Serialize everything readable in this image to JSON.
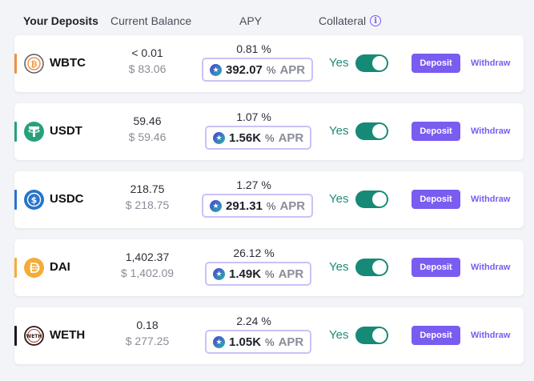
{
  "header": {
    "deposits": "Your Deposits",
    "balance": "Current Balance",
    "apy": "APY",
    "collateral": "Collateral"
  },
  "rows": [
    {
      "symbol": "WBTC",
      "balance": "< 0.01",
      "usd": "$ 83.06",
      "apy": "0.81 %",
      "apr": "392.07",
      "collateral": "Yes",
      "accent": "#f09242",
      "icon": "wbtc-icon"
    },
    {
      "symbol": "USDT",
      "balance": "59.46",
      "usd": "$ 59.46",
      "apy": "1.07 %",
      "apr": "1.56K",
      "collateral": "Yes",
      "accent": "#26a17b",
      "icon": "usdt-icon"
    },
    {
      "symbol": "USDC",
      "balance": "218.75",
      "usd": "$ 218.75",
      "apy": "1.27 %",
      "apr": "291.31",
      "collateral": "Yes",
      "accent": "#2775ca",
      "icon": "usdc-icon"
    },
    {
      "symbol": "DAI",
      "balance": "1,402.37",
      "usd": "$ 1,402.09",
      "apy": "26.12 %",
      "apr": "1.49K",
      "collateral": "Yes",
      "accent": "#f5ac37",
      "icon": "dai-icon"
    },
    {
      "symbol": "WETH",
      "balance": "0.18",
      "usd": "$ 277.25",
      "apy": "2.24 %",
      "apr": "1.05K",
      "collateral": "Yes",
      "accent": "#1a1a1a",
      "icon": "weth-icon"
    }
  ],
  "labels": {
    "apr_pct": "%",
    "apr": "APR",
    "deposit": "Deposit",
    "withdraw": "Withdraw"
  },
  "colors": {
    "brand": "#7a5cf0",
    "toggle_on": "#168a76"
  }
}
